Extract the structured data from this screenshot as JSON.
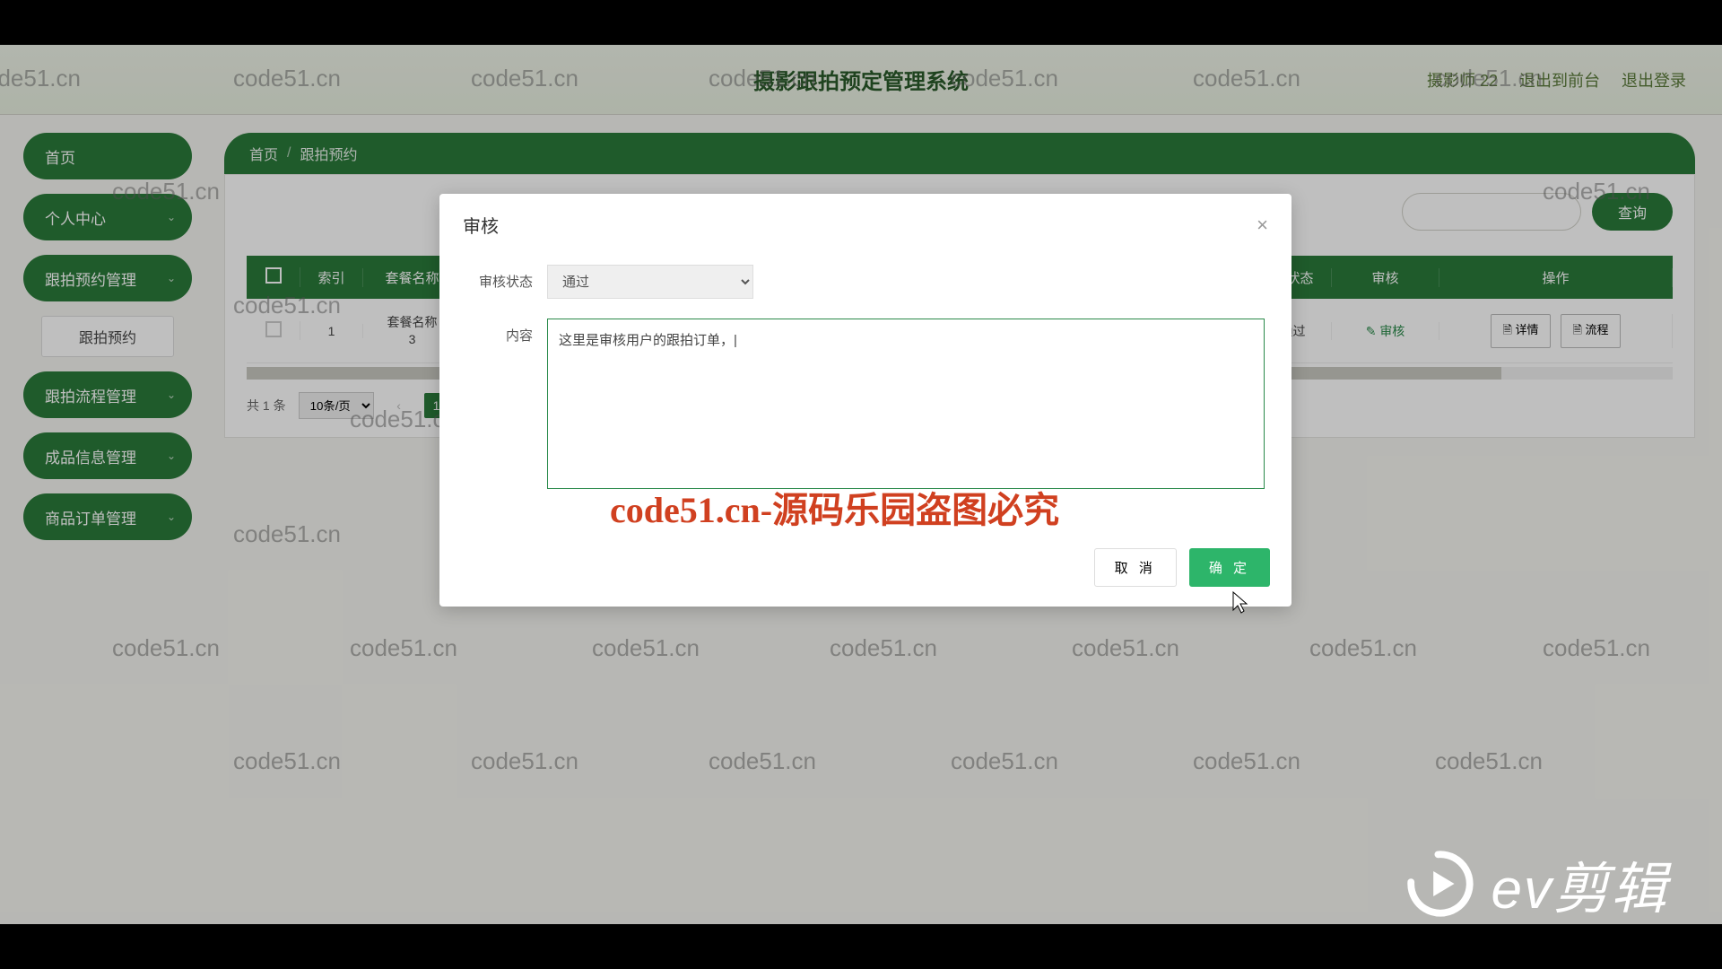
{
  "header": {
    "title": "摄影跟拍预定管理系统",
    "user": "摄影师 22",
    "front": "退出到前台",
    "logout": "退出登录"
  },
  "sidebar": {
    "home": "首页",
    "personal": "个人中心",
    "booking_mgmt": "跟拍预约管理",
    "booking_sub": "跟拍预约",
    "process_mgmt": "跟拍流程管理",
    "product_mgmt": "成品信息管理",
    "order_mgmt": "商品订单管理"
  },
  "breadcrumb": {
    "home": "首页",
    "current": "跟拍预约"
  },
  "search_btn": "查询",
  "table": {
    "headers": {
      "idx": "索引",
      "name": "套餐名称",
      "status": "审核状态",
      "audit": "审核",
      "ops": "操作"
    },
    "row": {
      "idx": "1",
      "name_l1": "套餐名称",
      "name_l2": "3",
      "status": "未通过",
      "audit_icon": "✎",
      "audit": "审核",
      "detail_icon": "🗎",
      "detail": "详情",
      "process_icon": "🗎",
      "process": "流程"
    }
  },
  "pager": {
    "total": "共 1 条",
    "size": "10条/页",
    "page": "1"
  },
  "modal": {
    "title": "审核",
    "status_label": "审核状态",
    "status_value": "通过",
    "content_label": "内容",
    "content_value": "这里是审核用户的跟拍订单，|",
    "cancel": "取 消",
    "ok": "确 定"
  },
  "center_watermark": "code51.cn-源码乐园盗图必究",
  "wm": "code51.cn",
  "ev": "ev剪辑"
}
